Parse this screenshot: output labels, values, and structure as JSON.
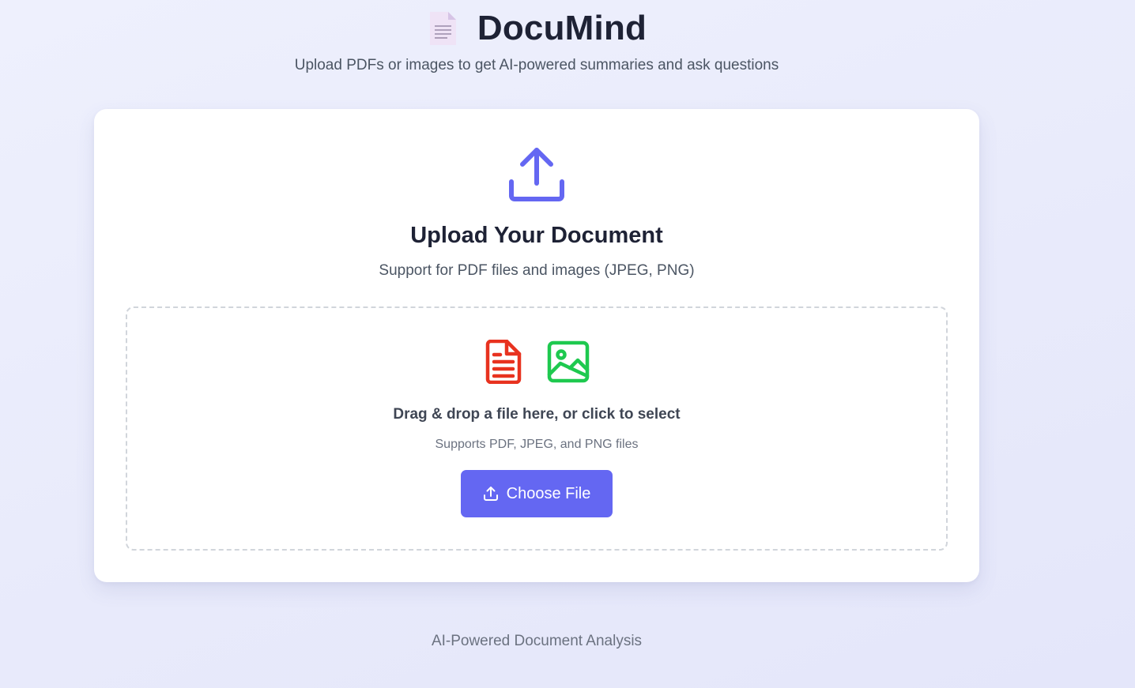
{
  "header": {
    "icon": "page-facing-up-icon",
    "title": "DocuMind",
    "subtitle": "Upload PDFs or images to get AI-powered summaries and ask questions"
  },
  "upload_card": {
    "icon": "upload-icon",
    "title": "Upload Your Document",
    "subtitle": "Support for PDF files and images (JPEG, PNG)",
    "dropzone": {
      "icons": [
        "file-text-icon",
        "image-icon"
      ],
      "prompt": "Drag & drop a file here, or click to select",
      "formats": "Supports PDF, JPEG, and PNG files",
      "button_label": "Choose File",
      "button_icon": "upload-icon"
    }
  },
  "footer": {
    "text": "AI-Powered Document Analysis"
  },
  "colors": {
    "accent": "#6467f2",
    "pdf_icon": "#e8321f",
    "image_icon": "#1ec94f",
    "title_text": "#1e2235"
  }
}
